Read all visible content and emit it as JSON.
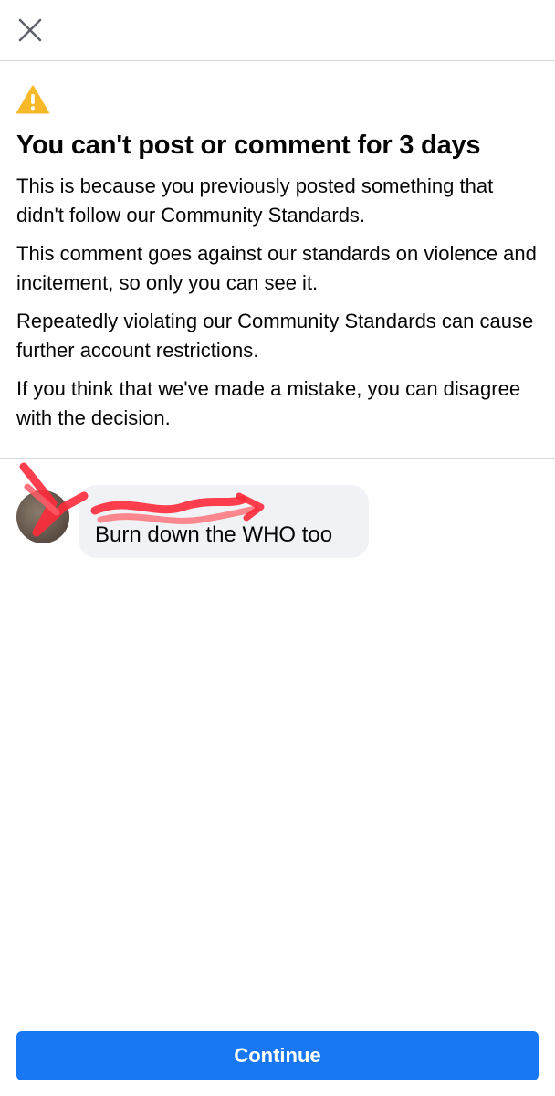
{
  "header": {
    "close_icon": "close-icon"
  },
  "notice": {
    "warning_icon": "warning-icon",
    "warning_color": "#f7b928",
    "title": "You can't post or comment for 3 days",
    "paragraphs": [
      "This is because you previously posted something that didn't follow our Community Standards.",
      "This comment goes against our standards on violence and incitement, so only you can see it.",
      "Repeatedly violating our Community Standards can cause further account restrictions.",
      "If you think that we've made a mistake, you can disagree with the decision."
    ]
  },
  "comment": {
    "text": "Burn down the WHO too",
    "bubble_color": "#f0f2f5"
  },
  "footer": {
    "continue_label": "Continue",
    "button_color": "#1877f2"
  }
}
